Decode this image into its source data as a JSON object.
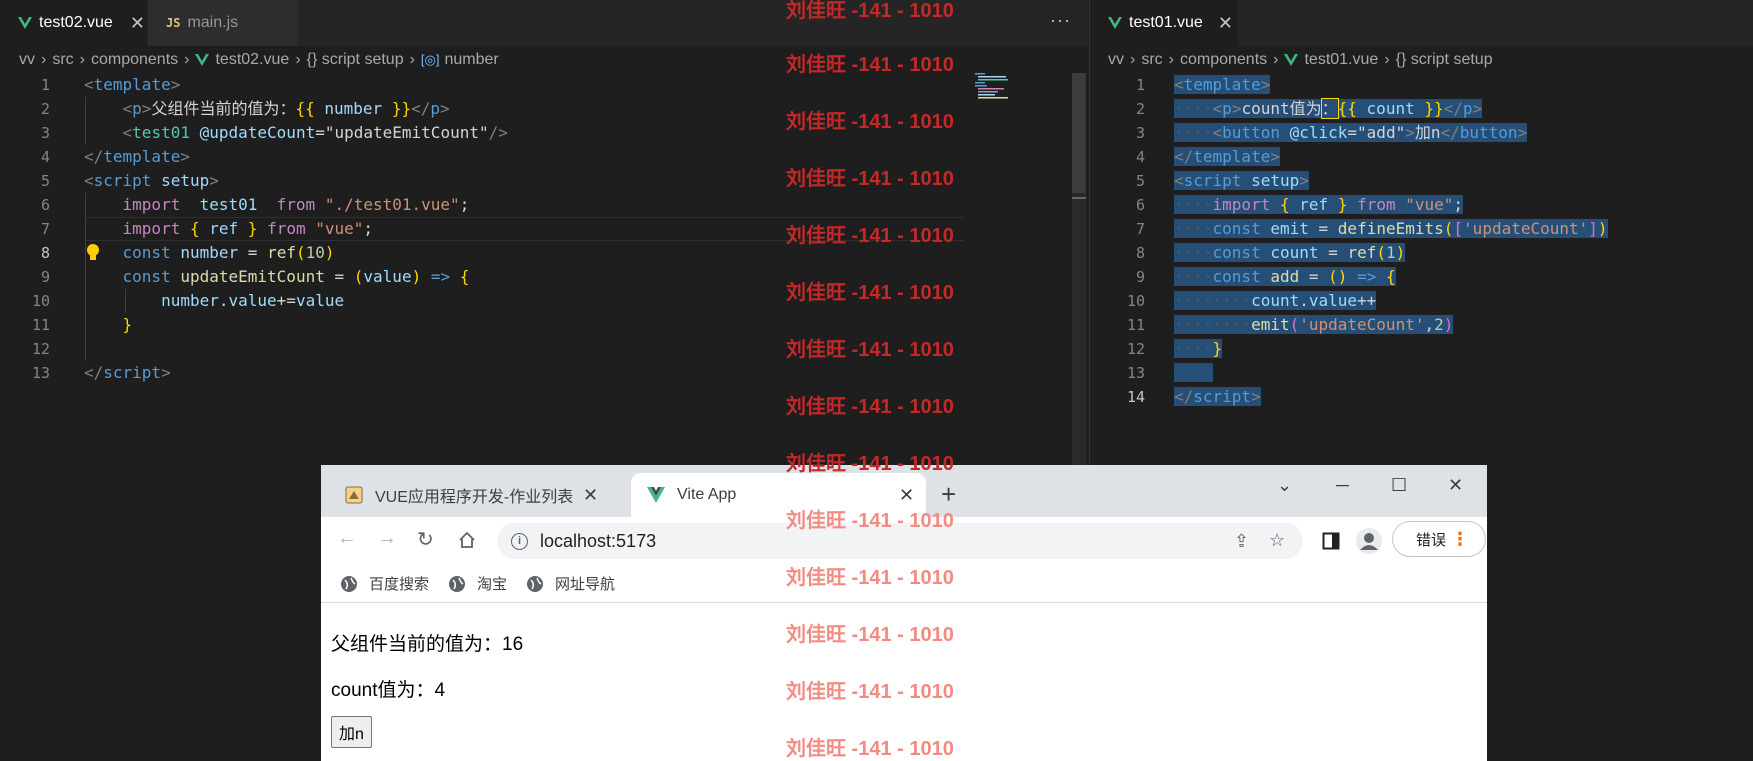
{
  "left_editor": {
    "tabs": [
      {
        "label": "test02.vue",
        "icon": "vue-icon",
        "active": true
      },
      {
        "label": "main.js",
        "icon": "js-icon",
        "active": false
      }
    ],
    "more_label": "···",
    "breadcrumb": [
      "vv",
      "src",
      "components",
      "test02.vue",
      "{} script setup",
      "number"
    ],
    "line_numbers": [
      "1",
      "2",
      "3",
      "4",
      "5",
      "6",
      "7",
      "8",
      "9",
      "10",
      "11",
      "12",
      "13"
    ]
  },
  "right_editor": {
    "tabs": [
      {
        "label": "test01.vue",
        "icon": "vue-icon",
        "active": true
      }
    ],
    "breadcrumb": [
      "vv",
      "src",
      "components",
      "test01.vue",
      "{} script setup"
    ],
    "line_numbers": [
      "1",
      "2",
      "3",
      "4",
      "5",
      "6",
      "7",
      "8",
      "9",
      "10",
      "11",
      "12",
      "13",
      "14"
    ]
  },
  "watermark": {
    "text": "刘佳旺 -141 - 1010",
    "color_dark": "#c62828",
    "color_light": "#f28b82"
  },
  "browser": {
    "tabs": [
      {
        "label": "VUE应用程序开发-作业列表",
        "active": false
      },
      {
        "label": "Vite App",
        "active": true
      }
    ],
    "new_tab": "+",
    "url": "localhost:5173",
    "profile_button": "错误",
    "bookmarks": [
      "百度搜索",
      "淘宝",
      "网址导航"
    ],
    "page": {
      "parent_text": "父组件当前的值为：16",
      "count_text": "count值为：4",
      "add_button": "加n"
    }
  },
  "colors": {
    "editor_bg": "#1e1e1e",
    "vue_green": "#41b883",
    "selection": "#264f78"
  }
}
